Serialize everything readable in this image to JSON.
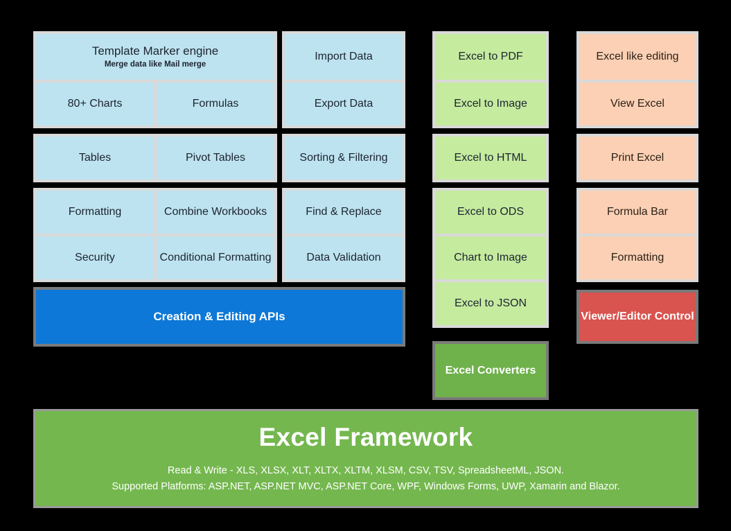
{
  "diagram": {
    "columns": [
      {
        "id": "creation-editing",
        "groups": [
          {
            "id": "template-charts-formulas",
            "rows": [
              [
                {
                  "title": "Template Marker engine",
                  "subtitle": "Merge data like Mail merge"
                }
              ],
              [
                {
                  "title": "80+ Charts"
                },
                {
                  "title": "Formulas"
                }
              ]
            ]
          },
          {
            "id": "tables-pivot",
            "rows": [
              [
                {
                  "title": "Tables"
                },
                {
                  "title": "Pivot Tables"
                }
              ]
            ]
          },
          {
            "id": "formatting-security",
            "rows": [
              [
                {
                  "title": "Formatting"
                },
                {
                  "title": "Combine Workbooks"
                }
              ],
              [
                {
                  "title": "Security"
                },
                {
                  "title": "Conditional Formatting"
                }
              ]
            ]
          }
        ]
      },
      {
        "id": "data-operations",
        "groups": [
          {
            "id": "import-export",
            "rows": [
              [
                {
                  "title": "Import Data"
                }
              ],
              [
                {
                  "title": "Export Data"
                }
              ]
            ]
          },
          {
            "id": "sorting-filtering",
            "rows": [
              [
                {
                  "title": "Sorting & Filtering"
                }
              ]
            ]
          },
          {
            "id": "find-validation",
            "rows": [
              [
                {
                  "title": "Find & Replace"
                }
              ],
              [
                {
                  "title": "Data Validation"
                }
              ]
            ]
          }
        ]
      },
      {
        "id": "converters",
        "groups": [
          {
            "id": "pdf-image",
            "rows": [
              [
                {
                  "title": "Excel to PDF"
                }
              ],
              [
                {
                  "title": "Excel to Image"
                }
              ]
            ]
          },
          {
            "id": "html",
            "rows": [
              [
                {
                  "title": "Excel to HTML"
                }
              ]
            ]
          },
          {
            "id": "ods-chart-json",
            "rows": [
              [
                {
                  "title": "Excel to ODS"
                }
              ],
              [
                {
                  "title": "Chart to Image"
                }
              ],
              [
                {
                  "title": "Excel to JSON"
                }
              ]
            ]
          }
        ]
      },
      {
        "id": "viewer-editor",
        "groups": [
          {
            "id": "editing-view",
            "rows": [
              [
                {
                  "title": "Excel like editing"
                }
              ],
              [
                {
                  "title": "View Excel"
                }
              ]
            ]
          },
          {
            "id": "print",
            "rows": [
              [
                {
                  "title": "Print Excel"
                }
              ]
            ]
          },
          {
            "id": "formula-formatting",
            "rows": [
              [
                {
                  "title": "Formula Bar"
                }
              ],
              [
                {
                  "title": "Formatting"
                }
              ]
            ]
          }
        ]
      }
    ],
    "banners": {
      "apis": "Creation & Editing APIs",
      "converters": "Excel Converters",
      "viewer": "Viewer/Editor Control"
    },
    "framework": {
      "title": "Excel Framework",
      "line1": "Read & Write - XLS, XLSX, XLT, XLTX, XLTM, XLSM, CSV, TSV, SpreadsheetML, JSON.",
      "line2": "Supported Platforms: ASP.NET, ASP.NET MVC, ASP.NET Core, WPF, Windows Forms, UWP, Xamarin and Blazor."
    }
  },
  "colors": {
    "background": "#000000",
    "card_blue": "#bee3f0",
    "card_green": "#c5eb9f",
    "card_peach": "#fbd0b4",
    "group_gap": "#d9d9d9",
    "banner_blue": "#0d78d7",
    "banner_dark_green": "#6fb14b",
    "banner_red": "#d9534f",
    "framework_green": "#74b74e",
    "banner_border": "#7a7a7a",
    "text_dark": "#1b2430",
    "text_light": "#ffffff"
  }
}
